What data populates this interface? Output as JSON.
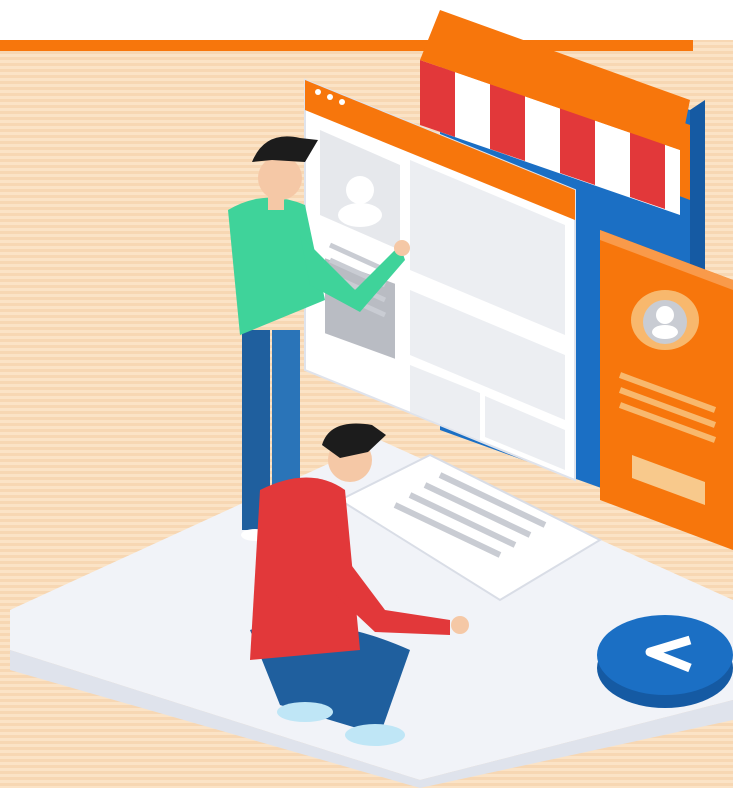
{
  "illustration": {
    "subject": "online-storefront",
    "colors": {
      "accent": "#f7760c",
      "background": "#fbe3c6",
      "blue": "#1b6fc4",
      "red": "#e2383a",
      "green": "#3fd39a",
      "denim": "#1f5f9e",
      "hair": "#1c1c1c",
      "skin": "#f5c8a6",
      "platform": "#f1f3f8"
    },
    "icons": [
      "shop-awning-icon",
      "user-avatar-icon",
      "back-arrow-icon"
    ]
  }
}
